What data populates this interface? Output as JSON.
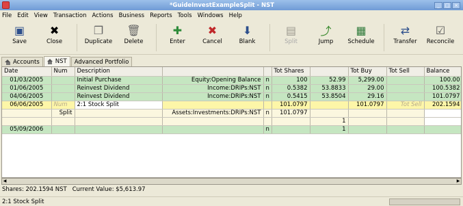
{
  "window": {
    "title": "*GuideInvestExampleSplit - NST"
  },
  "menu": [
    "File",
    "Edit",
    "View",
    "Transaction",
    "Actions",
    "Business",
    "Reports",
    "Tools",
    "Windows",
    "Help"
  ],
  "toolbar": {
    "save": "Save",
    "close": "Close",
    "duplicate": "Duplicate",
    "delete": "Delete",
    "enter": "Enter",
    "cancel": "Cancel",
    "blank": "Blank",
    "split": "Split",
    "jump": "Jump",
    "schedule": "Schedule",
    "transfer": "Transfer",
    "reconcile": "Reconcile"
  },
  "tabs": [
    "Accounts",
    "NST",
    "Advanced Portfolio"
  ],
  "table": {
    "headers": [
      "Date",
      "Num",
      "Description",
      "",
      "",
      "Tot Shares",
      "",
      "Tot Buy",
      "Tot Sell",
      "Balance"
    ],
    "rows": [
      {
        "date": "01/03/2005",
        "num": "",
        "desc": "Initial Purchase",
        "transfer": "Equity:Opening Balance",
        "r": "n",
        "shares": "100",
        "price": "52.99",
        "buy": "5,299.00",
        "sell": "",
        "balance": "100.00"
      },
      {
        "date": "01/06/2005",
        "num": "",
        "desc": "Reinvest Dividend",
        "transfer": "Income:DRIPs:NST",
        "r": "n",
        "shares": "0.5382",
        "price": "53.8833",
        "buy": "29.00",
        "sell": "",
        "balance": "100.5382"
      },
      {
        "date": "04/06/2005",
        "num": "",
        "desc": "Reinvest Dividend",
        "transfer": "Income:DRIPs:NST",
        "r": "n",
        "shares": "0.5415",
        "price": "53.8504",
        "buy": "29.16",
        "sell": "",
        "balance": "101.0797"
      },
      {
        "date": "06/06/2005",
        "num": "Num",
        "desc": "2:1 Stock Split",
        "transfer": "",
        "r": "",
        "shares": "101.0797",
        "price": "",
        "buy": "101.0797",
        "sell": "Tot Sell",
        "balance": "202.1594"
      }
    ],
    "split_row": {
      "action": "Split",
      "account": "Assets:Investments:DRIPs:NST",
      "r": "n",
      "shares": "101.0797"
    },
    "split_row2": {
      "price": "1"
    },
    "blank_row": {
      "date": "05/09/2006",
      "r": "n",
      "price": "1"
    }
  },
  "status": {
    "shares": "Shares: 202.1594 NST",
    "value": "Current Value: $5,613.97",
    "bottom": "2:1 Stock Split"
  }
}
